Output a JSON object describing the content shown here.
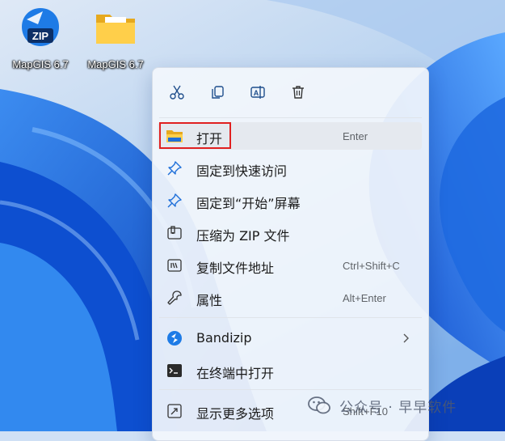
{
  "desktop": {
    "icons": [
      {
        "label": "MapGIS 6.7",
        "badge": "ZIP",
        "icon": "bandizip-zip-icon"
      },
      {
        "label": "MapGIS 6.7",
        "icon": "folder-icon"
      }
    ]
  },
  "context_menu": {
    "toolbar": [
      {
        "name": "cut-icon"
      },
      {
        "name": "copy-icon"
      },
      {
        "name": "rename-icon"
      },
      {
        "name": "delete-icon"
      }
    ],
    "items": [
      {
        "label": "打开",
        "shortcut": "Enter",
        "icon": "folder-icon"
      },
      {
        "label": "固定到快速访问",
        "icon": "pin-icon"
      },
      {
        "label": "固定到“开始”屏幕",
        "icon": "pin-icon"
      },
      {
        "label": "压缩为 ZIP 文件",
        "icon": "zip-archive-icon"
      },
      {
        "label": "复制文件地址",
        "shortcut": "Ctrl+Shift+C",
        "icon": "copy-path-icon"
      },
      {
        "label": "属性",
        "shortcut": "Alt+Enter",
        "icon": "wrench-icon"
      },
      {
        "label": "Bandizip",
        "icon": "bandizip-icon",
        "submenu": true
      },
      {
        "label": "在终端中打开",
        "icon": "terminal-icon"
      },
      {
        "label": "显示更多选项",
        "shortcut": "Shift+F10",
        "icon": "more-options-icon"
      }
    ]
  },
  "watermark": {
    "text": "公众号 · 早早软件"
  },
  "colors": {
    "accent": "#0067c0",
    "highlight_border": "#e02020",
    "menu_background": "#f2f6fc"
  }
}
